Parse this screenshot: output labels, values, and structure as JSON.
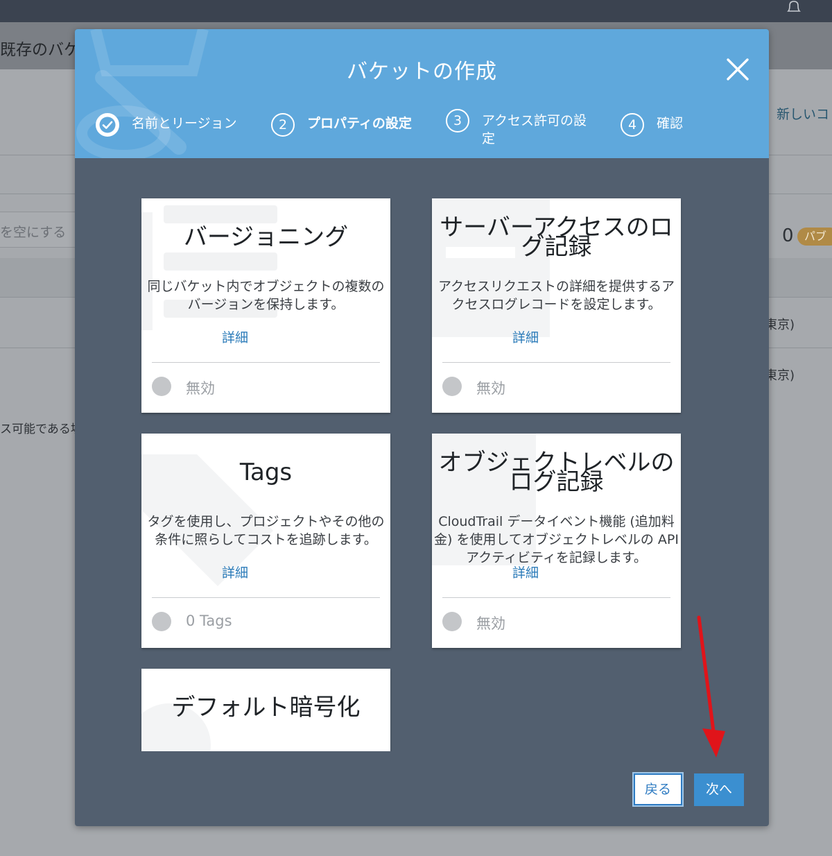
{
  "background": {
    "title": "既存のバケッ",
    "empty_label": "を空にする",
    "new_link": "新しいコ",
    "count": "0",
    "badge": "パブ",
    "region_1": "東京)",
    "region_2": "東京)",
    "note": "ス可能である場"
  },
  "modal": {
    "title": "バケットの作成",
    "steps": [
      {
        "number": "",
        "label": "名前とリージョン"
      },
      {
        "number": "2",
        "label": "プロパティの設定"
      },
      {
        "number": "3",
        "label": "アクセス許可の設定"
      },
      {
        "number": "4",
        "label": "確認"
      }
    ],
    "cards": [
      {
        "title": "バージョニング",
        "description": "同じバケット内でオブジェクトの複数のバージョンを保持します。",
        "link": "詳細",
        "status": "無効"
      },
      {
        "title": "サーバーアクセスのログ記録",
        "description": "アクセスリクエストの詳細を提供するアクセスログレコードを設定します。",
        "link": "詳細",
        "status": "無効"
      },
      {
        "title": "Tags",
        "description": "タグを使用し、プロジェクトやその他の条件に照らしてコストを追跡します。",
        "link": "詳細",
        "status": "0 Tags"
      },
      {
        "title": "オブジェクトレベルのログ記録",
        "description": "CloudTrail データイベント機能 (追加料金) を使用してオブジェクトレベルの API アクティビティを記録します。",
        "link": "詳細",
        "status": "無効"
      },
      {
        "title": "デフォルト暗号化",
        "description": "",
        "link": "",
        "status": ""
      }
    ],
    "buttons": {
      "back": "戻る",
      "next": "次へ"
    }
  },
  "colors": {
    "header_blue": "#5fa8dc",
    "modal_body": "#525f6f",
    "primary_button": "#3b8fd0",
    "annotation_arrow": "#e0141a"
  },
  "icons": [
    "bell-icon",
    "close-icon",
    "check-icon",
    "annotation-arrow"
  ]
}
